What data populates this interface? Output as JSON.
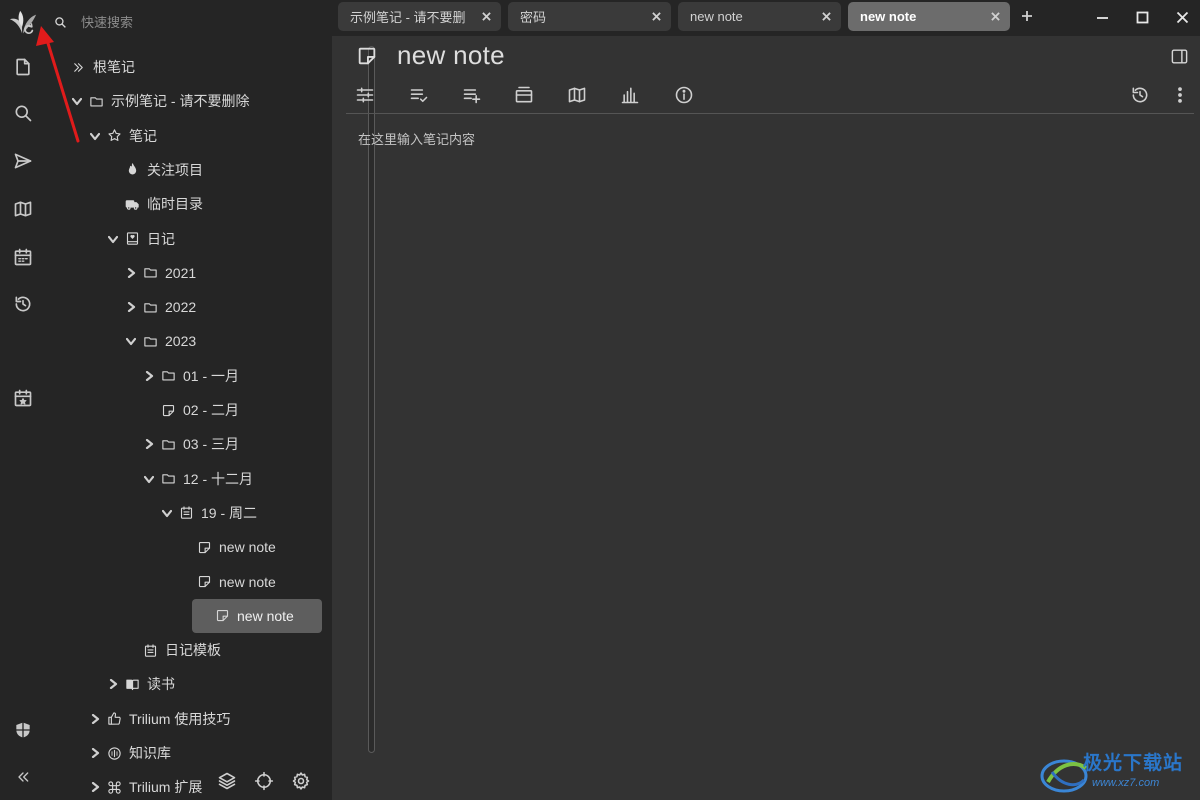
{
  "search": {
    "placeholder": "快速搜索"
  },
  "launcher": [
    {
      "name": "trilium-logo-icon"
    },
    {
      "name": "new-note-icon"
    },
    {
      "name": "search-icon"
    },
    {
      "name": "jump-to-note-icon"
    },
    {
      "name": "note-map-icon"
    },
    {
      "name": "calendar-icon"
    },
    {
      "name": "recent-changes-icon"
    },
    {
      "name": "today-note-icon"
    },
    {
      "name": "protected-session-icon"
    },
    {
      "name": "collapse-launcher-icon"
    }
  ],
  "tree": [
    {
      "label": "根笔记",
      "icon": "double-chevron-icon",
      "level": 0
    },
    {
      "label": "示例笔记 - 请不要删除",
      "icon": "folder-icon",
      "level": 1,
      "expanded": true
    },
    {
      "label": "笔记",
      "icon": "star-icon",
      "level": 2,
      "expanded": true
    },
    {
      "label": "关注项目",
      "icon": "fire-icon",
      "level": 3
    },
    {
      "label": "临时目录",
      "icon": "truck-icon",
      "level": 3
    },
    {
      "label": "日记",
      "icon": "book-icon",
      "level": 3,
      "expanded": true
    },
    {
      "label": "2021",
      "icon": "folder-icon",
      "level": 4,
      "expanded": false
    },
    {
      "label": "2022",
      "icon": "folder-icon",
      "level": 4,
      "expanded": false
    },
    {
      "label": "2023",
      "icon": "folder-icon",
      "level": 4,
      "expanded": true
    },
    {
      "label": "01 - 一月",
      "icon": "folder-icon",
      "level": 5,
      "expanded": false
    },
    {
      "label": "02 - 二月",
      "icon": "note-icon",
      "level": 5
    },
    {
      "label": "03 - 三月",
      "icon": "folder-icon",
      "level": 5,
      "expanded": false
    },
    {
      "label": "12 - 十二月",
      "icon": "folder-icon",
      "level": 5,
      "expanded": true
    },
    {
      "label": "19 - 周二",
      "icon": "calendar-day-icon",
      "level": 6,
      "expanded": true
    },
    {
      "label": "new note",
      "icon": "note-icon",
      "level": 7
    },
    {
      "label": "new note",
      "icon": "note-icon",
      "level": 7
    },
    {
      "label": "new note",
      "icon": "note-icon",
      "level": 7,
      "active": true
    },
    {
      "label": "日记模板",
      "icon": "calendar-day-icon",
      "level": 4
    },
    {
      "label": "读书",
      "icon": "book-open-icon",
      "level": 3,
      "expanded": false
    },
    {
      "label": "Trilium 使用技巧",
      "icon": "thumbs-up-icon",
      "level": 2,
      "expanded": false
    },
    {
      "label": "知识库",
      "icon": "info-circle-icon",
      "level": 2,
      "expanded": false
    },
    {
      "label": "Trilium 扩展",
      "icon": "command-icon",
      "level": 2,
      "expanded": false
    }
  ],
  "tree_bottom_buttons": [
    {
      "name": "layers-icon"
    },
    {
      "name": "locate-note-icon"
    },
    {
      "name": "settings-icon"
    }
  ],
  "tabs": [
    {
      "label": "示例笔记 - 请不要删",
      "active": false
    },
    {
      "label": "密码",
      "active": false
    },
    {
      "label": "new note",
      "active": false
    },
    {
      "label": "new note",
      "active": true
    }
  ],
  "note": {
    "title": "new note",
    "placeholder": "在这里输入笔记内容"
  },
  "toolbar": [
    {
      "name": "basic-properties-icon"
    },
    {
      "name": "promoted-attributes-icon"
    },
    {
      "name": "owned-attributes-icon"
    },
    {
      "name": "inherited-attributes-icon"
    },
    {
      "name": "note-map-icon"
    },
    {
      "name": "note-info-chart-icon"
    },
    {
      "name": "info-icon"
    },
    {
      "name": "note-revisions-icon"
    },
    {
      "name": "more-options-icon"
    }
  ],
  "watermark": {
    "text": "极光下载站",
    "url": "www.xz7.com"
  },
  "colors": {
    "sidebar_bg": "#252525",
    "main_bg": "#333333",
    "active_tab_bg": "#6c6c6c",
    "active_node_bg": "#5e5e5e",
    "annotation_arrow": "#e01b1b"
  }
}
